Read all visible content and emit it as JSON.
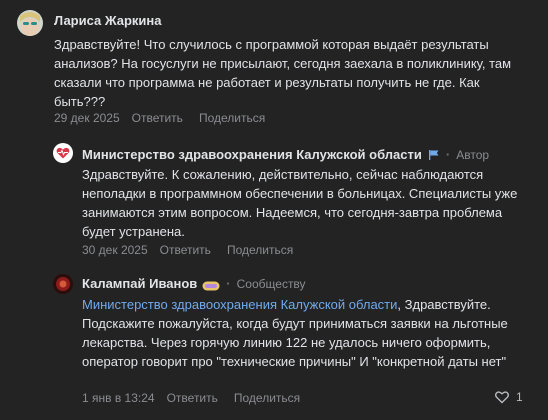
{
  "comments": [
    {
      "name": "Лариса Жаркина",
      "text": "Здравствуйте! Что случилось с программой которая выдаёт результаты анализов? На госуслуги не присылают, сегодня заехала в поликлинику, там сказали что программа не работает и результаты получить не где. Как быть???",
      "date": "29 дек 2025",
      "reply": "Ответить",
      "share": "Поделиться"
    },
    {
      "name": "Министерство здравоохранения Калужской области",
      "badge": "Автор",
      "text": "Здравствуйте. К сожалению, действительно, сейчас наблюдаются неполадки в программном обеспечении в больницах. Специалисты уже занимаются этим вопросом. Надеемся, что сегодня-завтра проблема будет устранена.",
      "date": "30 дек 2025",
      "reply": "Ответить",
      "share": "Поделиться"
    },
    {
      "name": "Калампай Иванов",
      "badge": "Сообществу",
      "mention": "Министерство здравоохранения Калужской области",
      "text": ", Здравствуйте. Подскажите пожалуйста, когда будут приниматься заявки на льготные лекарства. Через горячую линию 122 не удалось ничего оформить, оператор говорит про \"технические причины\" И \"конкретной даты нет\"",
      "date": "1 янв в 13:24",
      "reply": "Ответить",
      "share": "Поделиться",
      "likes": "1"
    }
  ],
  "colors": {
    "background": "#232324",
    "link": "#71aaeb",
    "muted": "#8a8c90"
  }
}
